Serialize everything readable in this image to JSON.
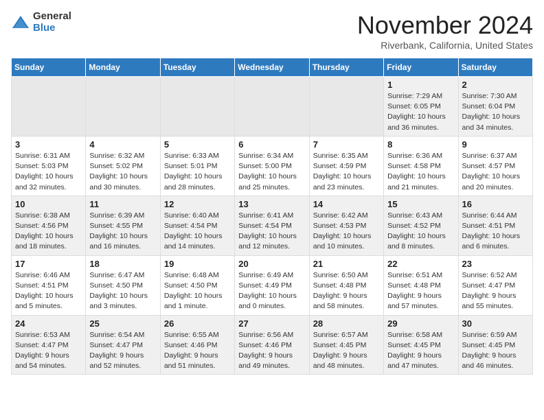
{
  "logo": {
    "general": "General",
    "blue": "Blue"
  },
  "header": {
    "month": "November 2024",
    "location": "Riverbank, California, United States"
  },
  "weekdays": [
    "Sunday",
    "Monday",
    "Tuesday",
    "Wednesday",
    "Thursday",
    "Friday",
    "Saturday"
  ],
  "weeks": [
    [
      {
        "day": "",
        "info": ""
      },
      {
        "day": "",
        "info": ""
      },
      {
        "day": "",
        "info": ""
      },
      {
        "day": "",
        "info": ""
      },
      {
        "day": "",
        "info": ""
      },
      {
        "day": "1",
        "info": "Sunrise: 7:29 AM\nSunset: 6:05 PM\nDaylight: 10 hours\nand 36 minutes."
      },
      {
        "day": "2",
        "info": "Sunrise: 7:30 AM\nSunset: 6:04 PM\nDaylight: 10 hours\nand 34 minutes."
      }
    ],
    [
      {
        "day": "3",
        "info": "Sunrise: 6:31 AM\nSunset: 5:03 PM\nDaylight: 10 hours\nand 32 minutes."
      },
      {
        "day": "4",
        "info": "Sunrise: 6:32 AM\nSunset: 5:02 PM\nDaylight: 10 hours\nand 30 minutes."
      },
      {
        "day": "5",
        "info": "Sunrise: 6:33 AM\nSunset: 5:01 PM\nDaylight: 10 hours\nand 28 minutes."
      },
      {
        "day": "6",
        "info": "Sunrise: 6:34 AM\nSunset: 5:00 PM\nDaylight: 10 hours\nand 25 minutes."
      },
      {
        "day": "7",
        "info": "Sunrise: 6:35 AM\nSunset: 4:59 PM\nDaylight: 10 hours\nand 23 minutes."
      },
      {
        "day": "8",
        "info": "Sunrise: 6:36 AM\nSunset: 4:58 PM\nDaylight: 10 hours\nand 21 minutes."
      },
      {
        "day": "9",
        "info": "Sunrise: 6:37 AM\nSunset: 4:57 PM\nDaylight: 10 hours\nand 20 minutes."
      }
    ],
    [
      {
        "day": "10",
        "info": "Sunrise: 6:38 AM\nSunset: 4:56 PM\nDaylight: 10 hours\nand 18 minutes."
      },
      {
        "day": "11",
        "info": "Sunrise: 6:39 AM\nSunset: 4:55 PM\nDaylight: 10 hours\nand 16 minutes."
      },
      {
        "day": "12",
        "info": "Sunrise: 6:40 AM\nSunset: 4:54 PM\nDaylight: 10 hours\nand 14 minutes."
      },
      {
        "day": "13",
        "info": "Sunrise: 6:41 AM\nSunset: 4:54 PM\nDaylight: 10 hours\nand 12 minutes."
      },
      {
        "day": "14",
        "info": "Sunrise: 6:42 AM\nSunset: 4:53 PM\nDaylight: 10 hours\nand 10 minutes."
      },
      {
        "day": "15",
        "info": "Sunrise: 6:43 AM\nSunset: 4:52 PM\nDaylight: 10 hours\nand 8 minutes."
      },
      {
        "day": "16",
        "info": "Sunrise: 6:44 AM\nSunset: 4:51 PM\nDaylight: 10 hours\nand 6 minutes."
      }
    ],
    [
      {
        "day": "17",
        "info": "Sunrise: 6:46 AM\nSunset: 4:51 PM\nDaylight: 10 hours\nand 5 minutes."
      },
      {
        "day": "18",
        "info": "Sunrise: 6:47 AM\nSunset: 4:50 PM\nDaylight: 10 hours\nand 3 minutes."
      },
      {
        "day": "19",
        "info": "Sunrise: 6:48 AM\nSunset: 4:50 PM\nDaylight: 10 hours\nand 1 minute."
      },
      {
        "day": "20",
        "info": "Sunrise: 6:49 AM\nSunset: 4:49 PM\nDaylight: 10 hours\nand 0 minutes."
      },
      {
        "day": "21",
        "info": "Sunrise: 6:50 AM\nSunset: 4:48 PM\nDaylight: 9 hours\nand 58 minutes."
      },
      {
        "day": "22",
        "info": "Sunrise: 6:51 AM\nSunset: 4:48 PM\nDaylight: 9 hours\nand 57 minutes."
      },
      {
        "day": "23",
        "info": "Sunrise: 6:52 AM\nSunset: 4:47 PM\nDaylight: 9 hours\nand 55 minutes."
      }
    ],
    [
      {
        "day": "24",
        "info": "Sunrise: 6:53 AM\nSunset: 4:47 PM\nDaylight: 9 hours\nand 54 minutes."
      },
      {
        "day": "25",
        "info": "Sunrise: 6:54 AM\nSunset: 4:47 PM\nDaylight: 9 hours\nand 52 minutes."
      },
      {
        "day": "26",
        "info": "Sunrise: 6:55 AM\nSunset: 4:46 PM\nDaylight: 9 hours\nand 51 minutes."
      },
      {
        "day": "27",
        "info": "Sunrise: 6:56 AM\nSunset: 4:46 PM\nDaylight: 9 hours\nand 49 minutes."
      },
      {
        "day": "28",
        "info": "Sunrise: 6:57 AM\nSunset: 4:45 PM\nDaylight: 9 hours\nand 48 minutes."
      },
      {
        "day": "29",
        "info": "Sunrise: 6:58 AM\nSunset: 4:45 PM\nDaylight: 9 hours\nand 47 minutes."
      },
      {
        "day": "30",
        "info": "Sunrise: 6:59 AM\nSunset: 4:45 PM\nDaylight: 9 hours\nand 46 minutes."
      }
    ]
  ]
}
